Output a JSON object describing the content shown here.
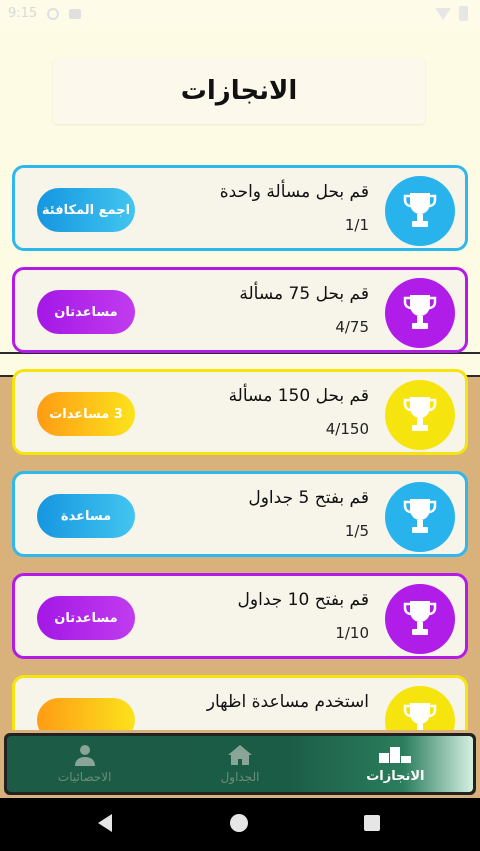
{
  "status_bar": {
    "time": "9:15"
  },
  "page_title": "الانجازات",
  "achievements": [
    {
      "title": "قم بحل مسألة واحدة",
      "progress": "1/1",
      "button": "اجمع المكافئة",
      "color": "blue"
    },
    {
      "title": "قم بحل 75 مسألة",
      "progress": "4/75",
      "button": "مساعدتان",
      "color": "purple"
    },
    {
      "title": "قم بحل 150 مسألة",
      "progress": "4/150",
      "button": "3 مساعدات",
      "color": "yellow"
    },
    {
      "title": "قم بفتح 5 جداول",
      "progress": "1/5",
      "button": "مساعدة",
      "color": "blue"
    },
    {
      "title": "قم بفتح 10 جداول",
      "progress": "1/10",
      "button": "مساعدتان",
      "color": "purple"
    },
    {
      "title": "استخدم مساعدة اظهار",
      "progress": "",
      "button": "",
      "color": "yellow"
    }
  ],
  "bottom_nav": {
    "items": [
      {
        "label": "الانجازات",
        "icon": "trophy-podium-icon",
        "active": true
      },
      {
        "label": "الجداول",
        "icon": "home-icon",
        "active": false
      },
      {
        "label": "الاحصائيات",
        "icon": "person-icon",
        "active": false
      }
    ]
  },
  "colors": {
    "blue": "#29b3ec",
    "purple": "#b01ce8",
    "yellow": "#f6e40e",
    "nav_green": "#1b5c46",
    "bg_cream": "#fdfbe4",
    "bg_tan": "#d8b27a"
  }
}
